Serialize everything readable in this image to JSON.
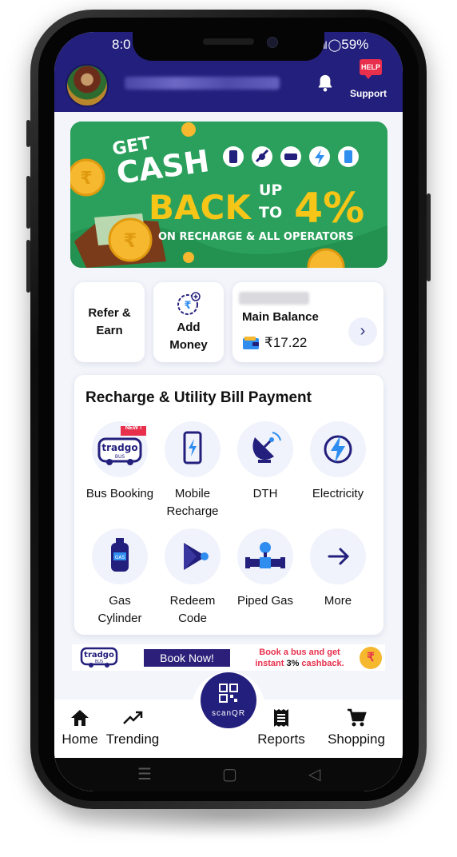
{
  "status_bar": {
    "time": "8:0",
    "battery": "59%"
  },
  "header": {
    "help_badge": "HELP",
    "support_label": "Support"
  },
  "banner": {
    "line1": "GET",
    "line2": "CASH",
    "line3": "BACK",
    "up_to": "UP",
    "to": "TO",
    "percent": "4%",
    "subtitle": "ON RECHARGE & ALL OPERATORS"
  },
  "quick_actions": {
    "refer": "Refer &\nEarn",
    "add_money": "Add\nMoney",
    "main_balance_label": "Main Balance",
    "balance_amount": "₹17.22"
  },
  "services": {
    "title": "Recharge & Utility Bill Payment",
    "items": [
      {
        "label": "Bus Booking",
        "icon": "bus-icon",
        "badge": "NEW !"
      },
      {
        "label": "Mobile\nRecharge",
        "icon": "mobile-icon"
      },
      {
        "label": "DTH",
        "icon": "satellite-dish-icon"
      },
      {
        "label": "Electricity",
        "icon": "lightning-icon"
      },
      {
        "label": "Gas\nCylinder",
        "icon": "gas-cylinder-icon"
      },
      {
        "label": "Redeem\nCode",
        "icon": "play-store-icon"
      },
      {
        "label": "Piped Gas",
        "icon": "gas-pipe-icon"
      },
      {
        "label": "More",
        "icon": "arrow-right-icon"
      }
    ]
  },
  "promo_strip": {
    "logo_text": "tradgo",
    "logo_sub": "BUS",
    "book_now": "Book Now!",
    "text_line1": "Book a bus and get",
    "text_prefix": "instant ",
    "text_highlight": "3%",
    "text_suffix": " cashback.",
    "coin": "₹"
  },
  "bottom_nav": {
    "home": "Home",
    "trending": "Trending",
    "scan": "scanQR",
    "reports": "Reports",
    "shopping": "Shopping"
  },
  "colors": {
    "primary": "#231f7c",
    "banner_green": "#2aa05c",
    "accent_yellow": "#f5c518",
    "help_red": "#e8304d",
    "icon_blue": "#2f8df0"
  }
}
